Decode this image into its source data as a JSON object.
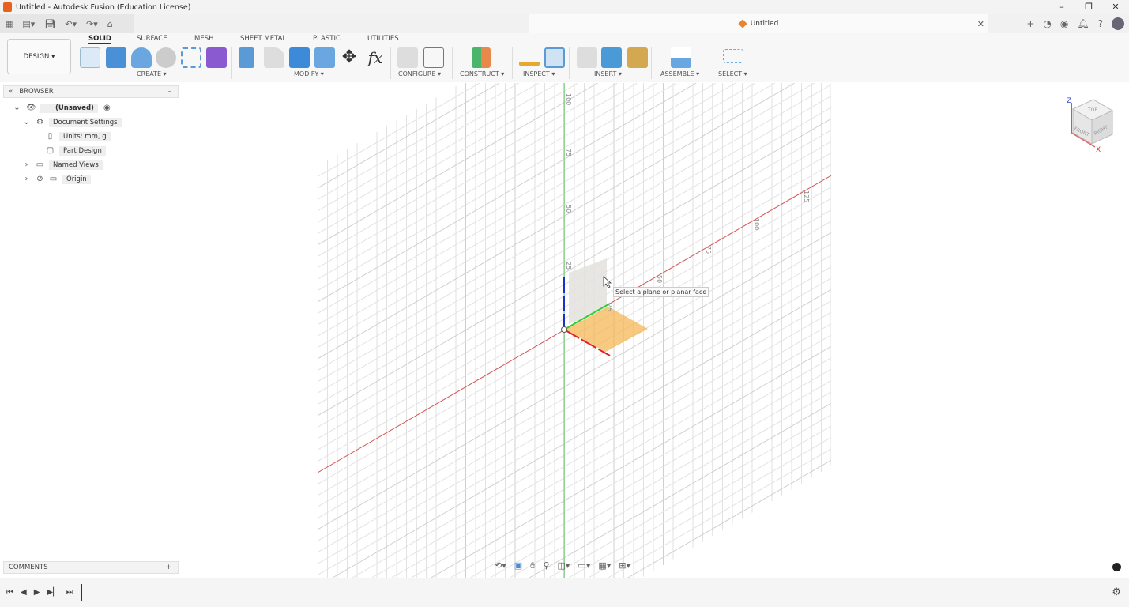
{
  "window": {
    "title": "Untitled - Autodesk Fusion (Education License)",
    "controls": [
      "minimize",
      "maximize",
      "close"
    ]
  },
  "document_tab": {
    "title": "Untitled"
  },
  "ribbon": {
    "workspace": "DESIGN ▾",
    "tabs": [
      "SOLID",
      "SURFACE",
      "MESH",
      "SHEET METAL",
      "PLASTIC",
      "UTILITIES"
    ],
    "active_tab": "SOLID",
    "groups": [
      "CREATE ▾",
      "MODIFY ▾",
      "CONFIGURE ▾",
      "CONSTRUCT ▾",
      "INSPECT ▾",
      "INSERT ▾",
      "ASSEMBLE ▾",
      "SELECT ▾"
    ]
  },
  "browser": {
    "title": "BROWSER",
    "items": [
      {
        "label": "(Unsaved)"
      },
      {
        "label": "Document Settings"
      },
      {
        "label": "Units: mm, g"
      },
      {
        "label": "Part Design"
      },
      {
        "label": "Named Views"
      },
      {
        "label": "Origin"
      }
    ]
  },
  "comments": {
    "title": "COMMENTS"
  },
  "viewport": {
    "tooltip": "Select a plane or planar face",
    "vertical_ticks": [
      "100",
      "75",
      "50",
      "25"
    ],
    "axis_ticks": [
      "25",
      "50",
      "75",
      "100",
      "125"
    ],
    "viewcube": {
      "top": "TOP",
      "front": "FRONT",
      "right": "RIGHT",
      "z": "Z",
      "x": "X"
    },
    "colors": {
      "x_axis": "#d03030",
      "y_axis": "#2fbf2f",
      "z_axis": "#1b2fcc",
      "plane": "#f5b24a"
    }
  }
}
